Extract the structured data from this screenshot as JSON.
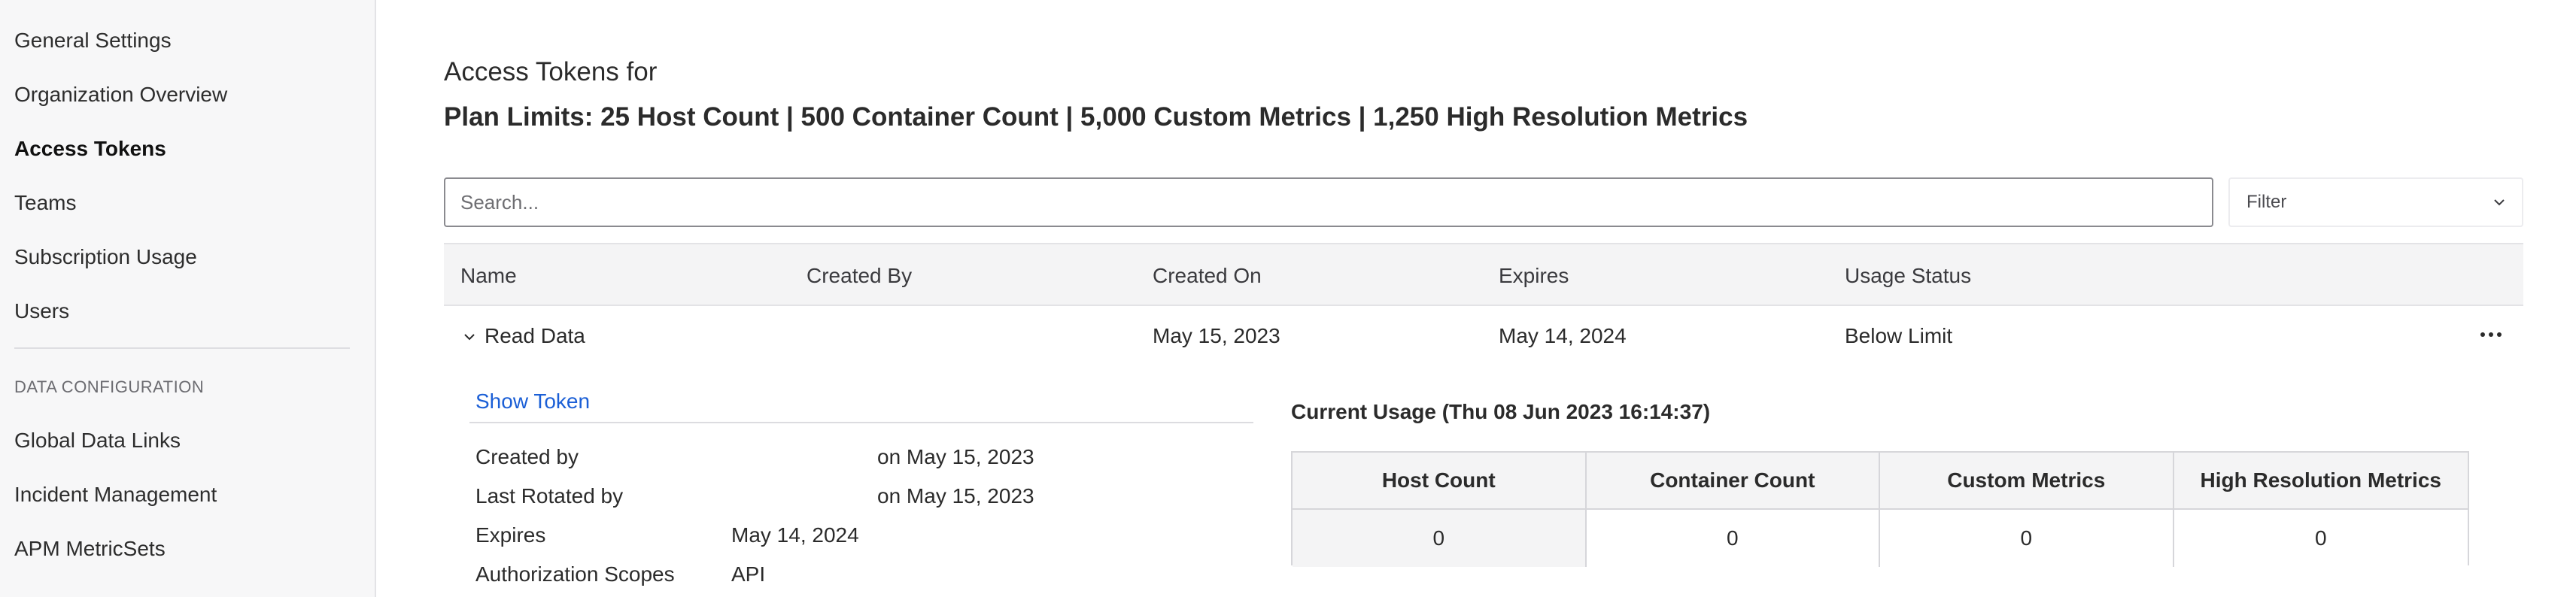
{
  "sidebar": {
    "items": [
      {
        "label": "General Settings"
      },
      {
        "label": "Organization Overview"
      },
      {
        "label": "Access Tokens"
      },
      {
        "label": "Teams"
      },
      {
        "label": "Subscription Usage"
      },
      {
        "label": "Users"
      }
    ],
    "section_heading": "DATA CONFIGURATION",
    "section_items": [
      {
        "label": "Global Data Links"
      },
      {
        "label": "Incident Management"
      },
      {
        "label": "APM MetricSets"
      }
    ]
  },
  "header": {
    "title": "Access Tokens for",
    "plan_limits": "Plan Limits: 25 Host Count | 500 Container Count | 5,000 Custom Metrics | 1,250 High Resolution Metrics"
  },
  "search": {
    "placeholder": "Search..."
  },
  "filter": {
    "label": "Filter",
    "icon": "chevron-down-icon"
  },
  "table": {
    "columns": [
      "Name",
      "Created By",
      "Created On",
      "Expires",
      "Usage Status"
    ],
    "rows": [
      {
        "name": "Read Data",
        "created_by": "",
        "created_on": "May 15, 2023",
        "expires": "May 14, 2024",
        "usage_status": "Below Limit"
      }
    ]
  },
  "details": {
    "show_token": "Show Token",
    "fields": [
      {
        "label": "Created by",
        "value": "on May 15, 2023"
      },
      {
        "label": "Last Rotated by",
        "value": "on May 15, 2023"
      },
      {
        "label": "Expires",
        "value": "May 14, 2024"
      },
      {
        "label": "Authorization Scopes",
        "value": "API"
      }
    ]
  },
  "usage": {
    "title": "Current Usage (Thu 08 Jun 2023 16:14:37)",
    "headers": [
      "Host Count",
      "Container Count",
      "Custom Metrics",
      "High Resolution Metrics"
    ],
    "values": [
      "0",
      "0",
      "0",
      "0"
    ]
  }
}
